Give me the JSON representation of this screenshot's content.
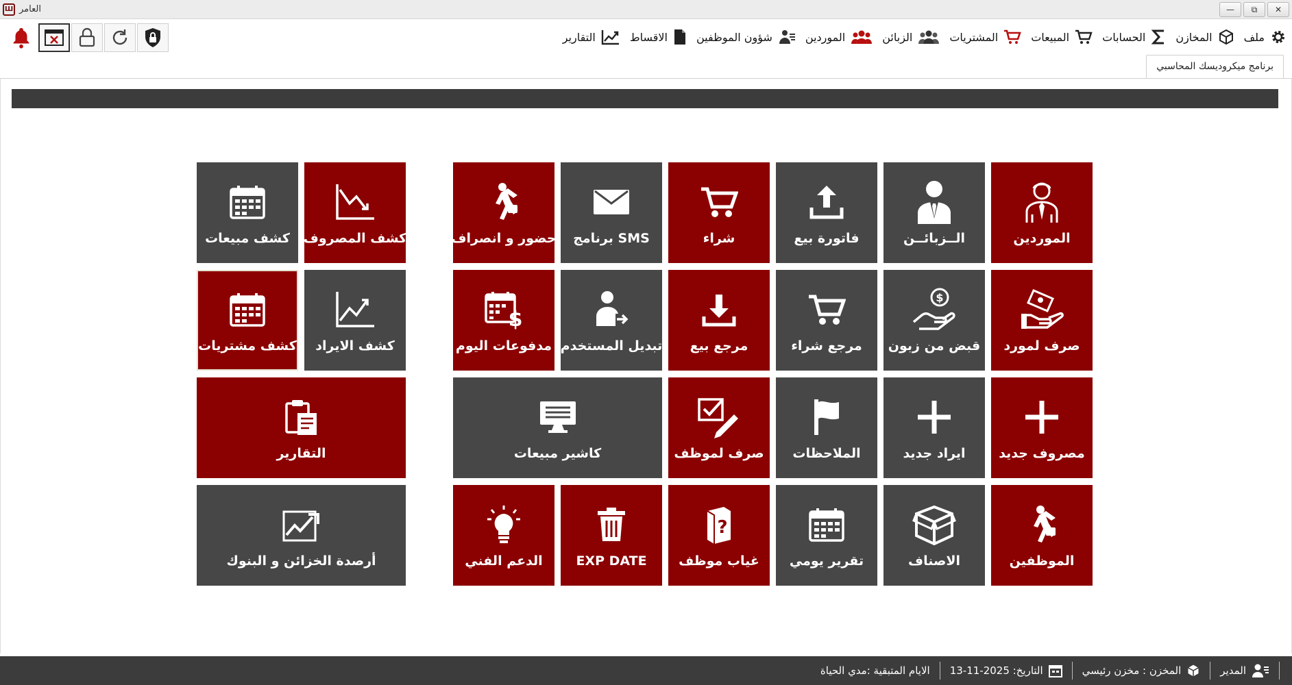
{
  "window": {
    "title": "العامر",
    "controls": {
      "minimize": "—",
      "restore": "⧉",
      "close": "✕"
    }
  },
  "menu": [
    {
      "label": "ملف",
      "icon": "gear-icon"
    },
    {
      "label": "المخازن",
      "icon": "box-icon"
    },
    {
      "label": "الحسابات",
      "icon": "sigma-icon"
    },
    {
      "label": "المبيعات",
      "icon": "cart-icon"
    },
    {
      "label": "المشتريات",
      "icon": "cart-red-icon"
    },
    {
      "label": "الزبائن",
      "icon": "group-icon"
    },
    {
      "label": "الموردين",
      "icon": "group-red-icon"
    },
    {
      "label": "شؤون الموظفين",
      "icon": "employee-icon"
    },
    {
      "label": "الاقساط",
      "icon": "document-icon"
    },
    {
      "label": "التقارير",
      "icon": "trend-icon"
    }
  ],
  "tab": {
    "label": "برنامج ميكروديسك المحاسبي"
  },
  "tiles": {
    "suppliers": "الموردين",
    "customers": "الــزبائــن",
    "sales_invoice": "فاتورة بيع",
    "purchase": "شراء",
    "sms": "برنامج SMS",
    "attendance": "حضور و انصراف",
    "expense_report": "كشف المصروف",
    "sales_report": "كشف مبيعات",
    "pay_supplier": "صرف لمورد",
    "receive_customer": "قبض من زبون",
    "purchase_return": "مرجع شراء",
    "sales_return": "مرجع بيع",
    "switch_user": "تبديل المستخدم",
    "today_payments": "مدفوعات اليوم",
    "income_report": "كشف الايراد",
    "purchases_report": "كشف مشتريات",
    "new_expense": "مصروف جديد",
    "new_income": "ايراد جديد",
    "notes": "الملاحظات",
    "pay_employee": "صرف لموظف",
    "sales_cashier": "كاشير مبيعات",
    "reports": "التقارير",
    "employees": "الموظفين",
    "items": "الاصناف",
    "daily_report": "تقرير يومي",
    "employee_absence": "غياب موظف",
    "exp_date": "EXP DATE",
    "support": "الدعم الفني",
    "treasury_balances": "أرصدة الخزائن و البنوك"
  },
  "status": {
    "user": "المدير",
    "store": "المخزن : مخزن رئيسي",
    "date": "التاريخ: 2025-11-13",
    "remaining_days": "الايام المتبقية :مدي الحياة"
  }
}
